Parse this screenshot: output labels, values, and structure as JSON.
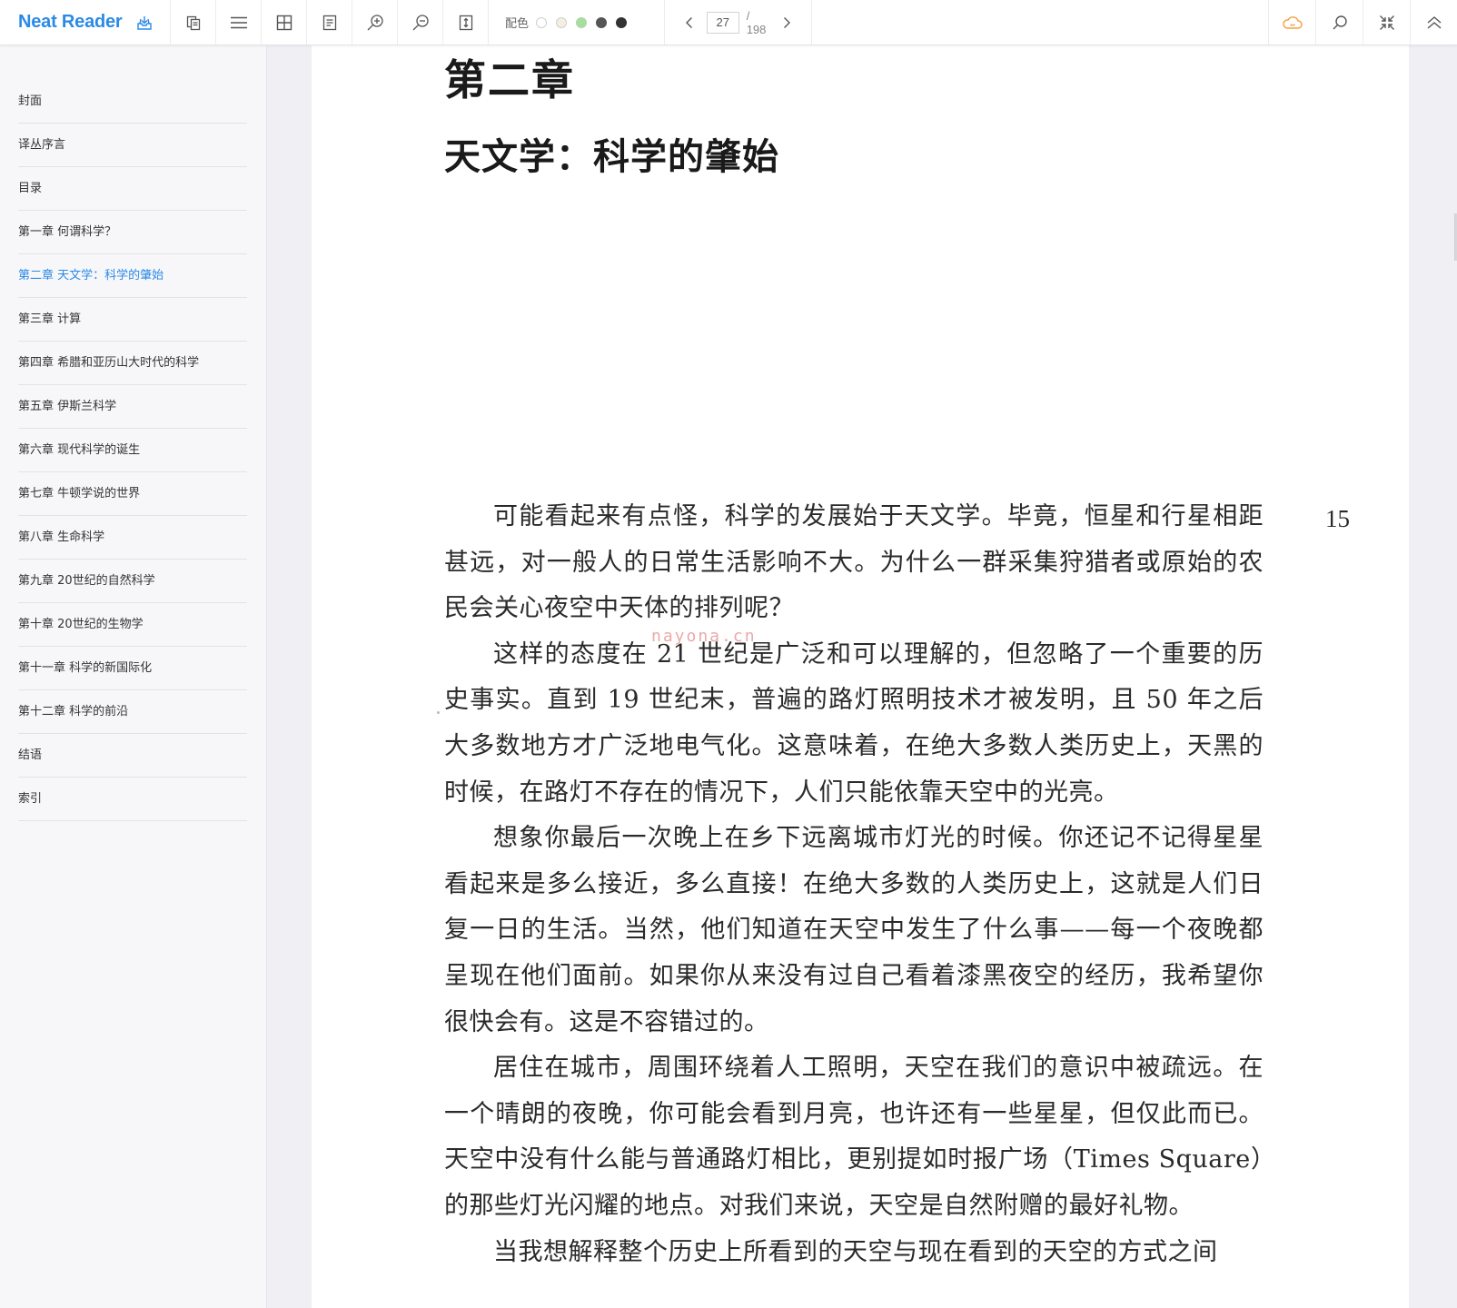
{
  "app": {
    "title": "Neat Reader"
  },
  "toolbar": {
    "left_icons": [
      {
        "name": "copy-pages-icon"
      },
      {
        "name": "toc-list-icon"
      },
      {
        "name": "grid-view-icon"
      },
      {
        "name": "notes-icon"
      },
      {
        "name": "zoom-in-icon"
      },
      {
        "name": "zoom-out-icon"
      },
      {
        "name": "fit-height-icon"
      }
    ],
    "theme_label": "配色",
    "theme_colors": [
      "#ffffff",
      "#f4efe2",
      "#a8dca0",
      "#555555",
      "#333333"
    ],
    "page": {
      "current": "27",
      "total_label": "/ 198"
    },
    "right_icons": [
      {
        "name": "cloud-sync-icon"
      },
      {
        "name": "search-icon"
      },
      {
        "name": "collapse-icon"
      },
      {
        "name": "double-chevron-up-icon"
      }
    ],
    "accent_color": "#2a8ae6",
    "cloud_color": "#f0a040"
  },
  "sidebar": {
    "toc": [
      {
        "label": "封面",
        "active": false
      },
      {
        "label": "译丛序言",
        "active": false
      },
      {
        "label": "目录",
        "active": false
      },
      {
        "label": "第一章 何谓科学？",
        "active": false
      },
      {
        "label": "第二章 天文学：科学的肇始",
        "active": true
      },
      {
        "label": "第三章 计算",
        "active": false
      },
      {
        "label": "第四章 希腊和亚历山大时代的科学",
        "active": false
      },
      {
        "label": "第五章 伊斯兰科学",
        "active": false
      },
      {
        "label": "第六章 现代科学的诞生",
        "active": false
      },
      {
        "label": "第七章 牛顿学说的世界",
        "active": false
      },
      {
        "label": "第八章 生命科学",
        "active": false
      },
      {
        "label": "第九章 20世纪的自然科学",
        "active": false
      },
      {
        "label": "第十章 20世纪的生物学",
        "active": false
      },
      {
        "label": "第十一章 科学的新国际化",
        "active": false
      },
      {
        "label": "第十二章 科学的前沿",
        "active": false
      },
      {
        "label": "结语",
        "active": false
      },
      {
        "label": "索引",
        "active": false
      }
    ]
  },
  "page_content": {
    "chapter_number": "第二章",
    "chapter_title": "天文学：科学的肇始",
    "page_number": "15",
    "watermark": "nayona.cn",
    "paragraphs": [
      "可能看起来有点怪，科学的发展始于天文学。毕竟，恒星和行星相距甚远，对一般人的日常生活影响不大。为什么一群采集狩猎者或原始的农民会关心夜空中天体的排列呢？",
      "这样的态度在 21 世纪是广泛和可以理解的，但忽略了一个重要的历史事实。直到 19 世纪末，普遍的路灯照明技术才被发明，且 50 年之后大多数地方才广泛地电气化。这意味着，在绝大多数人类历史上，天黑的时候，在路灯不存在的情况下，人们只能依靠天空中的光亮。",
      "想象你最后一次晚上在乡下远离城市灯光的时候。你还记不记得星星看起来是多么接近，多么直接！在绝大多数的人类历史上，这就是人们日复一日的生活。当然，他们知道在天空中发生了什么事——每一个夜晚都呈现在他们面前。如果你从来没有过自己看着漆黑夜空的经历，我希望你很快会有。这是不容错过的。",
      "居住在城市，周围环绕着人工照明，天空在我们的意识中被疏远。在一个晴朗的夜晚，你可能会看到月亮，也许还有一些星星，但仅此而已。天空中没有什么能与普通路灯相比，更别提如时报广场（Times Square）的那些灯光闪耀的地点。对我们来说，天空是自然附赠的最好礼物。",
      "当我想解释整个历史上所看到的天空与现在看到的天空的方式之间"
    ]
  }
}
